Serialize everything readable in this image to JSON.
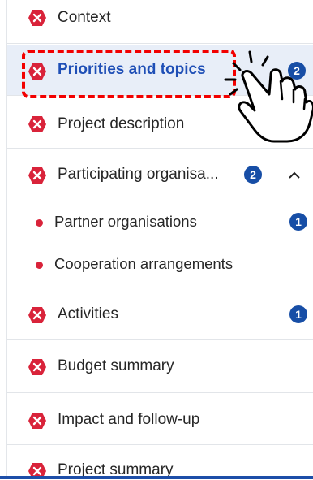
{
  "nav": {
    "items": [
      {
        "label": "Context",
        "status": "error"
      },
      {
        "label": "Priorities and topics",
        "status": "error",
        "active": true,
        "badge": "2"
      },
      {
        "label": "Project description",
        "status": "error"
      },
      {
        "label": "Participating organisa...",
        "status": "error",
        "badge": "2",
        "expanded": true,
        "children": [
          {
            "label": "Partner organisations",
            "badge": "1"
          },
          {
            "label": "Cooperation arrangements"
          }
        ]
      },
      {
        "label": "Activities",
        "status": "error",
        "badge": "1"
      },
      {
        "label": "Budget summary",
        "status": "error"
      },
      {
        "label": "Impact and follow-up",
        "status": "error"
      },
      {
        "label": "Project summary",
        "status": "error"
      }
    ]
  },
  "icons": {
    "error": "error-hexagon-icon",
    "chevron": "chevron-up-icon",
    "cursor": "hand-pointer-icon"
  },
  "colors": {
    "error_red": "#d9233a",
    "badge_blue": "#174ea6",
    "active_text": "#1f4fb6",
    "active_bg": "#e8eef8",
    "highlight": "#f20000"
  }
}
